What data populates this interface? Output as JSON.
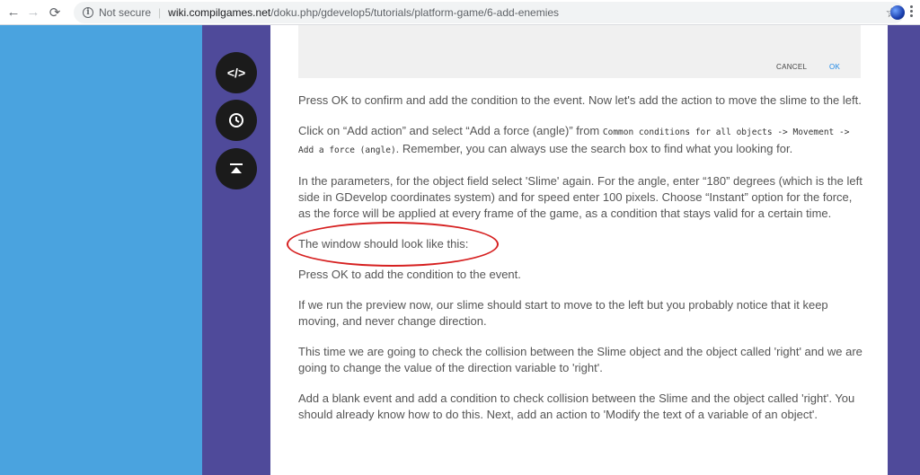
{
  "browser": {
    "security_label": "Not secure",
    "url_host": "wiki.compilgames.net",
    "url_path": "/doku.php/gdevelop5/tutorials/platform-game/6-add-enemies",
    "icons": [
      "back-arrow-icon",
      "forward-arrow-icon",
      "reload-icon",
      "info-icon",
      "star-icon",
      "profile-avatar",
      "menu-dots-icon"
    ]
  },
  "tools": {
    "icons": [
      "code-icon",
      "clock-icon",
      "back-to-top-icon"
    ],
    "code_glyph": "</>",
    "clock_glyph": "◷",
    "top_glyph": "⭱"
  },
  "dialog": {
    "cancel_label": "CANCEL",
    "ok_label": "OK"
  },
  "article": {
    "p1": "Press OK to confirm and add the condition to the event. Now let's add the action to move the slime to the left.",
    "p2_start": "Click on “Add action” and select “Add a force (angle)” from ",
    "p2_code": "Common conditions for all objects -> Movement -> Add a force (angle)",
    "p2_end": ". Remember, you can always use the search box to find what you looking for.",
    "p3": "In the parameters, for the object field select 'Slime' again. For the angle, enter “180” degrees (which is the left side in GDevelop coordinates system) and for speed enter 100 pixels. Choose “Instant” option for the force, as the force will be applied at every frame of the game, as a condition that stays valid for a certain time.",
    "p4": "The window should look like this:",
    "p5": "Press OK to add the condition to the event.",
    "p6": "If we run the preview now, our slime should start to move to the left but you probably notice that it keep moving, and never change direction.",
    "p7": "This time we are going to check the collision between the Slime object and the object called 'right' and we are going to change the value of the direction variable to 'right'.",
    "p8": "Add a blank event and add a condition to check collision between the Slime and the object called 'right'. You should already know how to do this. Next, add an action to 'Modify the text of a variable of an object'."
  },
  "colors": {
    "left_blue": "#4aa3df",
    "side_purple": "#4f4a9a",
    "annotation_red": "#d62020",
    "ok_blue": "#1e88e5"
  }
}
